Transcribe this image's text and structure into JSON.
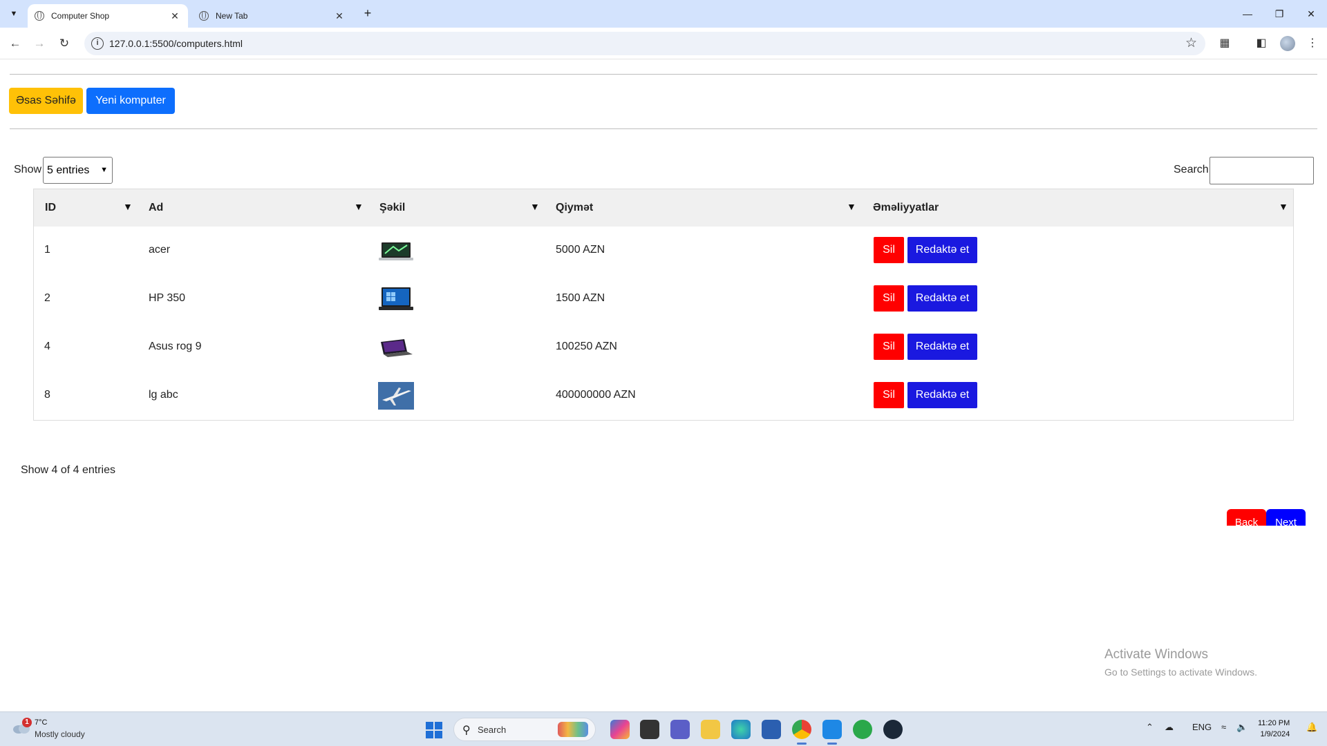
{
  "browser": {
    "tabs": [
      {
        "title": "Computer Shop",
        "active": true
      },
      {
        "title": "New Tab",
        "active": false
      }
    ],
    "url": "127.0.0.1:5500/computers.html"
  },
  "nav": {
    "home_label": "Əsas Səhifə",
    "new_label": "Yeni komputer"
  },
  "controls": {
    "show_label": "Show",
    "entries_selected": "5 entries",
    "search_label": "Search",
    "search_value": ""
  },
  "table": {
    "columns": [
      "ID",
      "Ad",
      "Şəkil",
      "Qiymət",
      "Əməliyyatlar"
    ],
    "rows": [
      {
        "id": "1",
        "name": "acer",
        "image": "laptop-acer",
        "price": "5000 AZN",
        "delete_label": "Sil",
        "edit_label": "Redaktə et"
      },
      {
        "id": "2",
        "name": "HP 350",
        "image": "laptop-hp",
        "price": "1500 AZN",
        "delete_label": "Sil",
        "edit_label": "Redaktə et"
      },
      {
        "id": "4",
        "name": "Asus rog 9",
        "image": "laptop-asus",
        "price": "100250 AZN",
        "delete_label": "Sil",
        "edit_label": "Redaktə et"
      },
      {
        "id": "8",
        "name": "lg abc",
        "image": "airplane",
        "price": "400000000 AZN",
        "delete_label": "Sil",
        "edit_label": "Redaktə et"
      }
    ]
  },
  "footer": {
    "info": "Show 4 of 4 entries",
    "back_label": "Back",
    "next_label": "Next"
  },
  "watermark": {
    "title": "Activate Windows",
    "subtitle": "Go to Settings to activate Windows."
  },
  "taskbar": {
    "weather_badge": "1",
    "temperature": "7°C",
    "weather": "Mostly cloudy",
    "search_label": "Search",
    "language": "ENG",
    "time": "11:20 PM",
    "date": "1/9/2024"
  },
  "colors": {
    "home_button": "#ffc107",
    "new_button": "#0d6efd",
    "delete_button": "#ff0000",
    "edit_button": "#1a19e0",
    "next_button": "#0000ff"
  }
}
